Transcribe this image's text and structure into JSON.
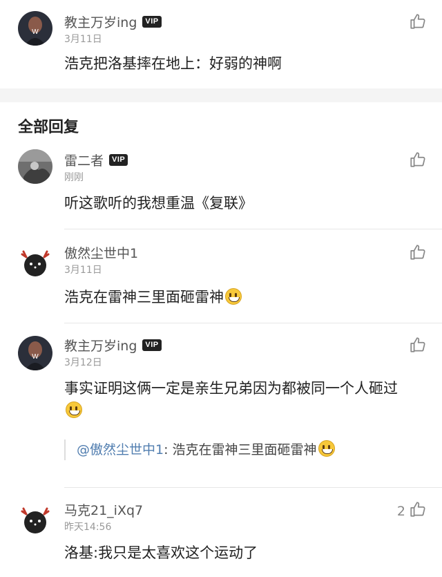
{
  "top_comment": {
    "username": "教主万岁ing",
    "vip": "VIP",
    "date": "3月11日",
    "text": "浩克把洛基摔在地上：好弱的神啊"
  },
  "section_title": "全部回复",
  "replies": [
    {
      "username": "雷二者",
      "vip": "VIP",
      "date": "刚刚",
      "text": "听这歌听的我想重温《复联》"
    },
    {
      "username": "傲然尘世中1",
      "date": "3月11日",
      "text": "浩克在雷神三里面砸雷神"
    },
    {
      "username": "教主万岁ing",
      "vip": "VIP",
      "date": "3月12日",
      "text": "事实证明这俩一定是亲生兄弟因为都被同一个人砸过",
      "quote": {
        "mention": "@傲然尘世中1",
        "text": ": 浩克在雷神三里面砸雷神"
      }
    },
    {
      "username": "马克21_iXq7",
      "date": "昨天14:56",
      "text": "洛基:我只是太喜欢这个运动了",
      "likes": "2"
    }
  ],
  "icons": {
    "like": "thumbs-up-icon",
    "emoji": "grinning-face-icon"
  },
  "colors": {
    "mention": "#507daf",
    "vip_badge": "#222222",
    "section_gap": "#f4f4f4"
  }
}
